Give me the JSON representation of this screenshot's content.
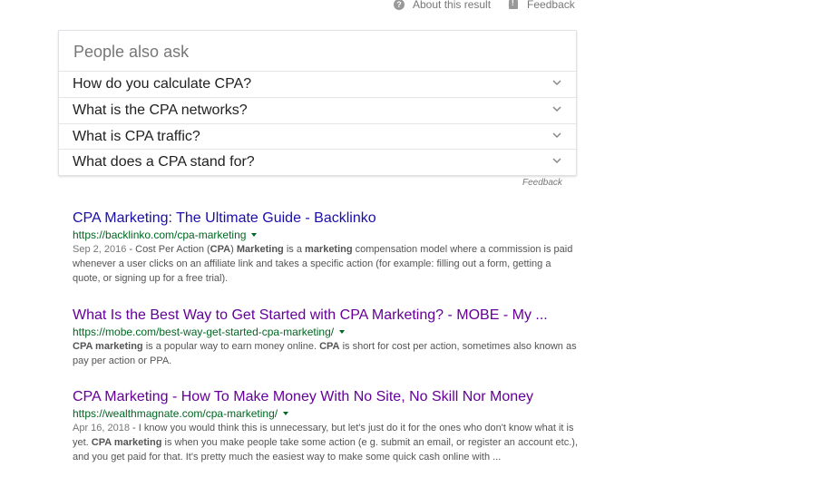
{
  "topbar": {
    "about_label": "About this result",
    "feedback_label": "Feedback"
  },
  "paa": {
    "title": "People also ask",
    "questions": [
      "How do you calculate CPA?",
      "What is the CPA networks?",
      "What is CPA traffic?",
      "What does a CPA stand for?"
    ],
    "feedback_label": "Feedback"
  },
  "results": [
    {
      "title": "CPA Marketing: The Ultimate Guide - Backlinko",
      "url": "https://backlinko.com/cpa-marketing",
      "date": "Sep 2, 2016",
      "snippet_html": "<span class=\"date\">Sep 2, 2016</span> - Cost Per Action (<b>CPA</b>) <b>Marketing</b> is a <b>marketing</b> compensation model where a commission is paid whenever a user clicks on an affiliate link and takes a specific action (for example: filling out a form, getting a quote, or signing up for a free trial)."
    },
    {
      "title": "What Is the Best Way to Get Started with CPA Marketing? - MOBE - My ...",
      "url": "https://mobe.com/best-way-get-started-cpa-marketing/",
      "snippet_html": "<b>CPA marketing</b> is a popular way to earn money online. <b>CPA</b> is short for cost per action, sometimes also known as pay per action or PPA."
    },
    {
      "title": "CPA Marketing - How To Make Money With No Site, No Skill Nor Money",
      "url": "https://wealthmagnate.com/cpa-marketing/",
      "date": "Apr 16, 2018",
      "snippet_html": "<span class=\"date\">Apr 16, 2018</span> - I know you would think this is unnecessary, but let's just do it for the ones who don't know what it is yet. <b>CPA marketing</b> is when you make people take some action (e g. submit an email, or register an account etc.), and you get paid for that. It's pretty much the easiest way to make some quick cash online with ..."
    }
  ],
  "colors": {
    "link": "#1a0dab",
    "visited": "#660099",
    "url": "#006621",
    "snippet": "#545454"
  },
  "icons": [
    "question-icon",
    "feedback-icon",
    "chevron-down-icon",
    "dropdown-arrow-icon"
  ]
}
